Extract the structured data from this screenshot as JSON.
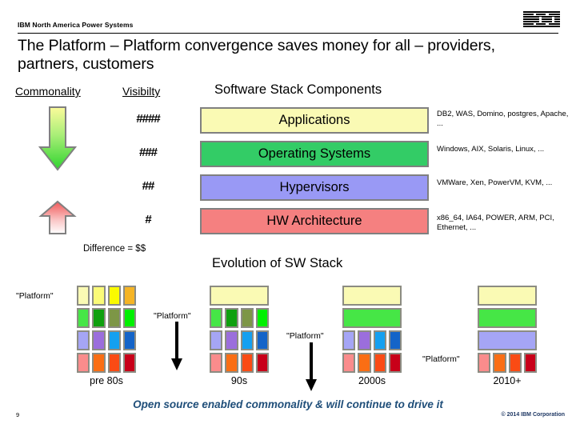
{
  "header": {
    "eyebrow": "IBM North America Power Systems",
    "logo_name": "ibm-logo"
  },
  "title": "The Platform – Platform convergence saves money for all – providers, partners, customers",
  "headings": {
    "commonality": "Commonality",
    "visibility": "Visibilty",
    "software_stack": "Software Stack Components",
    "evolution": "Evolution of SW Stack"
  },
  "difference_label": "Difference = $$",
  "stack": {
    "layers": [
      {
        "name": "applications",
        "label": "Applications",
        "hash": "####",
        "note": "DB2, WAS, Domino, postgres, Apache, ...",
        "color": "#FAFAB4"
      },
      {
        "name": "operating-systems",
        "label": "Operating Systems",
        "hash": "###",
        "note": "Windows, AIX, Solaris, Linux, ...",
        "color": "#33CC66"
      },
      {
        "name": "hypervisors",
        "label": "Hypervisors",
        "hash": "##",
        "note": "VMWare, Xen, PowerVM, KVM, ...",
        "color": "#9999F5"
      },
      {
        "name": "hw-architecture",
        "label": "HW Architecture",
        "hash": "#",
        "note": "x86_64, IA64, POWER, ARM, PCI, Ethernet, ...",
        "color": "#F58080"
      }
    ]
  },
  "arrows": {
    "commonality_arrow": "down-arrow-yellow-green",
    "cost_arrow": "up-arrow-red",
    "flow_arrow": "down-arrow-black"
  },
  "platform_tag": "\"Platform\"",
  "eras": [
    {
      "name": "pre-80s",
      "label": "pre 80s",
      "rows": [
        {
          "merged": false,
          "colors": [
            "#FAFAB4",
            "#FAFA78",
            "#FAFA00",
            "#F5B425"
          ]
        },
        {
          "merged": false,
          "colors": [
            "#46E646",
            "#0FA00F",
            "#7D9646",
            "#00F000"
          ]
        },
        {
          "merged": false,
          "colors": [
            "#A5A5F5",
            "#9B6EDC",
            "#14A0F0",
            "#1464C8"
          ]
        },
        {
          "merged": false,
          "colors": [
            "#FA8C8C",
            "#FA6E14",
            "#FA4B14",
            "#C80019"
          ]
        }
      ]
    },
    {
      "name": "90s",
      "label": "90s",
      "rows": [
        {
          "merged": true,
          "colors": [
            "#FAFAB4"
          ]
        },
        {
          "merged": false,
          "colors": [
            "#46E646",
            "#0FA00F",
            "#7D9646",
            "#00F000"
          ]
        },
        {
          "merged": false,
          "colors": [
            "#A5A5F5",
            "#9B6EDC",
            "#14A0F0",
            "#1464C8"
          ]
        },
        {
          "merged": false,
          "colors": [
            "#FA8C8C",
            "#FA6E14",
            "#FA4B14",
            "#C80019"
          ]
        }
      ]
    },
    {
      "name": "2000s",
      "label": "2000s",
      "rows": [
        {
          "merged": true,
          "colors": [
            "#FAFAB4"
          ]
        },
        {
          "merged": true,
          "colors": [
            "#46E646"
          ]
        },
        {
          "merged": false,
          "colors": [
            "#A5A5F5",
            "#9B6EDC",
            "#14A0F0",
            "#1464C8"
          ]
        },
        {
          "merged": false,
          "colors": [
            "#FA8C8C",
            "#FA6E14",
            "#FA4B14",
            "#C80019"
          ]
        }
      ]
    },
    {
      "name": "2010plus",
      "label": "2010+",
      "rows": [
        {
          "merged": true,
          "colors": [
            "#FAFAB4"
          ]
        },
        {
          "merged": true,
          "colors": [
            "#46E646"
          ]
        },
        {
          "merged": true,
          "colors": [
            "#A5A5F5"
          ]
        },
        {
          "merged": false,
          "colors": [
            "#FA8C8C",
            "#FA6E14",
            "#FA4B14",
            "#C80019"
          ]
        }
      ]
    }
  ],
  "footer": {
    "tagline": "Open source enabled commonality & will continue to drive it",
    "slide_number": "9",
    "copyright": "© 2014 IBM Corporation"
  }
}
